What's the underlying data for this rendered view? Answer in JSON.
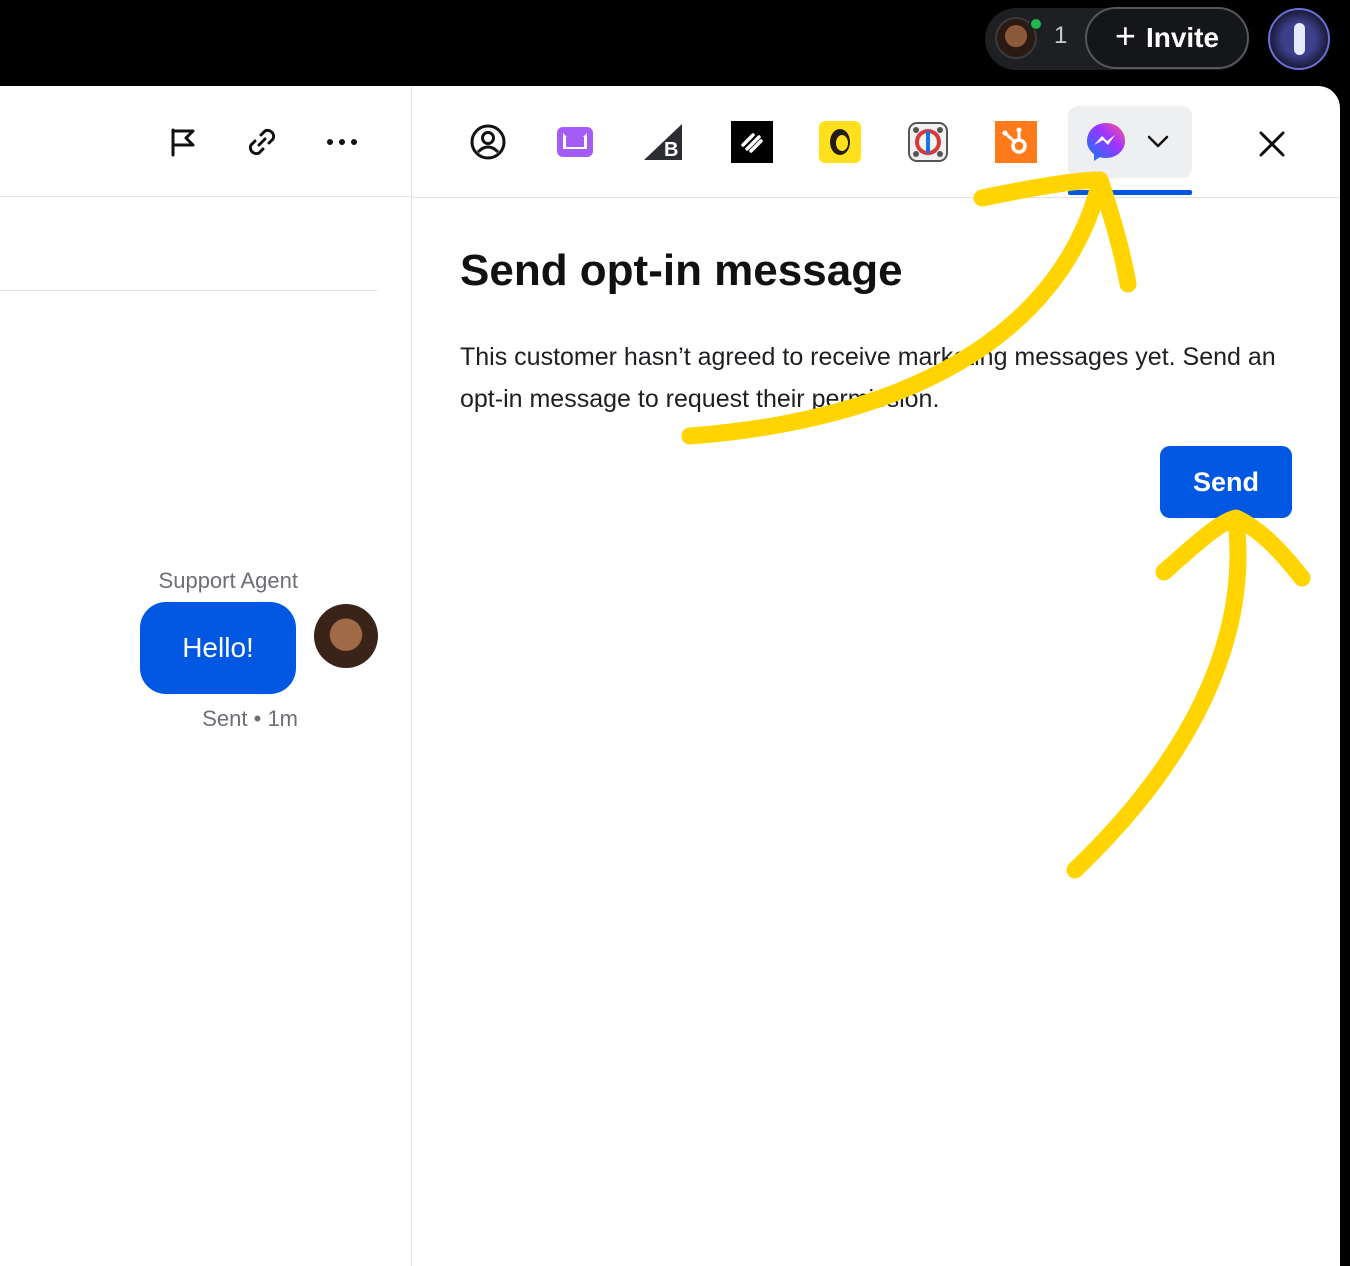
{
  "topbar": {
    "presence_count": "1",
    "invite_label": "Invite"
  },
  "conversation": {
    "author": "Support Agent",
    "message": "Hello!",
    "status": "Sent",
    "time": "1m"
  },
  "panel": {
    "title": "Send opt-in message",
    "description": "This customer hasn’t agreed to receive marketing messages yet. Send an opt-in message to request their permission.",
    "send_label": "Send"
  },
  "apps": [
    "profile-icon",
    "klaviyo-icon",
    "bigcommerce-icon",
    "squarespace-icon",
    "mailchimp-icon",
    "integration-icon",
    "hubspot-icon",
    "messenger-icon"
  ],
  "colors": {
    "accent": "#0057e2",
    "annotation": "#ffd400",
    "hubspot": "#ff7a1a",
    "mailchimp": "#ffe01b"
  }
}
